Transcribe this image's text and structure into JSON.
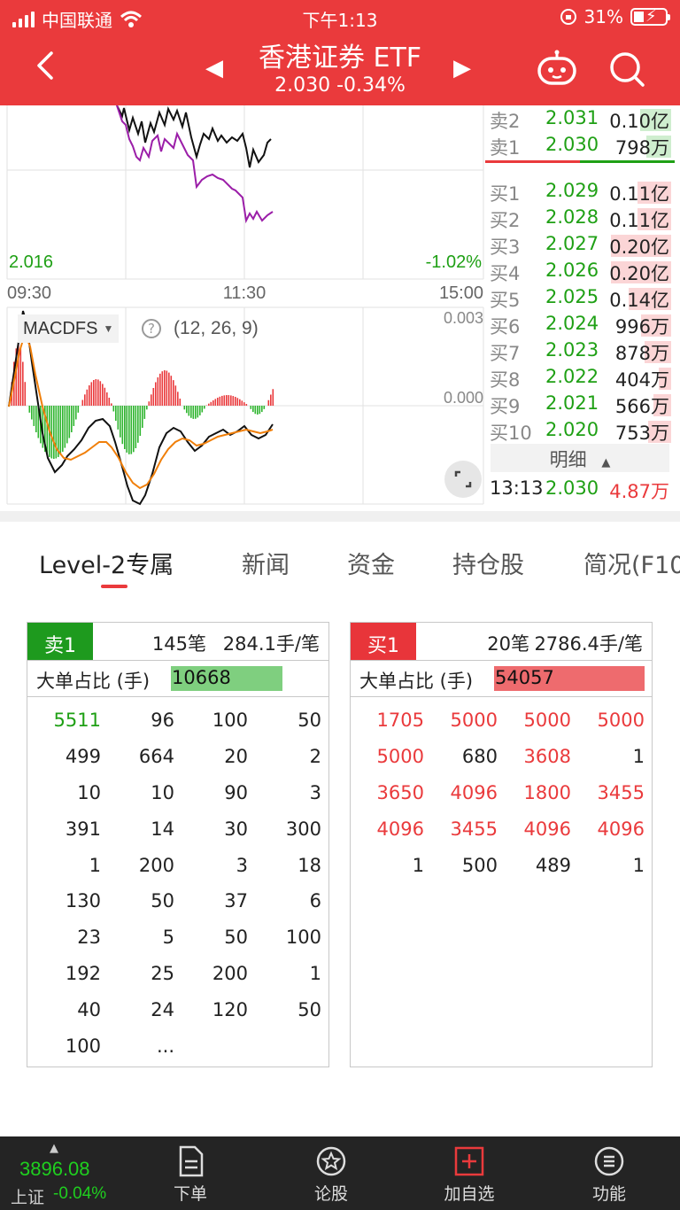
{
  "status_bar": {
    "carrier": "中国联通",
    "time": "下午1:13",
    "battery": "31%"
  },
  "header": {
    "title": "香港证券 ETF",
    "price_change": "2.030  -0.34%"
  },
  "chart": {
    "price_low_label": "2.016",
    "pct_low_label": "-1.02%",
    "time_labels": [
      "09:30",
      "11:30",
      "15:00"
    ],
    "indicator_name": "MACDFS",
    "indicator_params": "(12, 26, 9)",
    "help_icon": "?",
    "macd_top_label": "0.003",
    "macd_zero_label": "0.000"
  },
  "order_book": {
    "rows": [
      {
        "label": "卖2",
        "price": "2.031",
        "volume": "0.10亿",
        "side": "sell",
        "share": 0.35
      },
      {
        "label": "卖1",
        "price": "2.030",
        "volume": "798万",
        "side": "sell",
        "share": 0.28
      },
      {
        "label": "买1",
        "price": "2.029",
        "volume": "0.11亿",
        "side": "buy",
        "share": 0.38
      },
      {
        "label": "买2",
        "price": "2.028",
        "volume": "0.11亿",
        "side": "buy",
        "share": 0.38
      },
      {
        "label": "买3",
        "price": "2.027",
        "volume": "0.20亿",
        "side": "buy",
        "share": 0.68
      },
      {
        "label": "买4",
        "price": "2.026",
        "volume": "0.20亿",
        "side": "buy",
        "share": 0.68
      },
      {
        "label": "买5",
        "price": "2.025",
        "volume": "0.14亿",
        "side": "buy",
        "share": 0.48
      },
      {
        "label": "买6",
        "price": "2.024",
        "volume": "996万",
        "side": "buy",
        "share": 0.34
      },
      {
        "label": "买7",
        "price": "2.023",
        "volume": "878万",
        "side": "buy",
        "share": 0.3
      },
      {
        "label": "买8",
        "price": "2.022",
        "volume": "404万",
        "side": "buy",
        "share": 0.14
      },
      {
        "label": "买9",
        "price": "2.021",
        "volume": "566万",
        "side": "buy",
        "share": 0.2
      },
      {
        "label": "买10",
        "price": "2.020",
        "volume": "753万",
        "side": "buy",
        "share": 0.26
      }
    ],
    "detail_label": "明细",
    "last_trade": {
      "time": "13:13",
      "price": "2.030",
      "volume": "4.87万"
    }
  },
  "tabs": [
    "Level-2专属",
    "新闻",
    "资金",
    "持仓股",
    "简况(F10"
  ],
  "sell_panel": {
    "badge": "卖1",
    "trades": "145笔",
    "avg": "284.1手/笔",
    "ratio_label": "大单占比 (手)",
    "ratio_value": "10668",
    "grid": [
      [
        "5511",
        "96",
        "100",
        "50"
      ],
      [
        "499",
        "664",
        "20",
        "2"
      ],
      [
        "10",
        "10",
        "90",
        "3"
      ],
      [
        "391",
        "14",
        "30",
        "300"
      ],
      [
        "1",
        "200",
        "3",
        "18"
      ],
      [
        "130",
        "50",
        "37",
        "6"
      ],
      [
        "23",
        "5",
        "50",
        "100"
      ],
      [
        "192",
        "25",
        "200",
        "1"
      ],
      [
        "40",
        "24",
        "120",
        "50"
      ],
      [
        "100",
        "...",
        "",
        ""
      ]
    ]
  },
  "buy_panel": {
    "badge": "买1",
    "trades": "20笔",
    "avg": "2786.4手/笔",
    "ratio_label": "大单占比 (手)",
    "ratio_value": "54057",
    "grid": [
      [
        "1705",
        "5000",
        "5000",
        "5000"
      ],
      [
        "5000",
        "680",
        "3608",
        "1"
      ],
      [
        "3650",
        "4096",
        "1800",
        "3455"
      ],
      [
        "4096",
        "3455",
        "4096",
        "4096"
      ],
      [
        "1",
        "500",
        "489",
        "1"
      ]
    ]
  },
  "bottom_bar": {
    "index_value": "3896.08",
    "index_name": "上证",
    "index_change": "-0.04%",
    "items": [
      "下单",
      "论股",
      "加自选",
      "功能"
    ]
  },
  "colors": {
    "red": "#ea3a3c",
    "green": "#1fa015",
    "purple": "#9b1ea8"
  }
}
